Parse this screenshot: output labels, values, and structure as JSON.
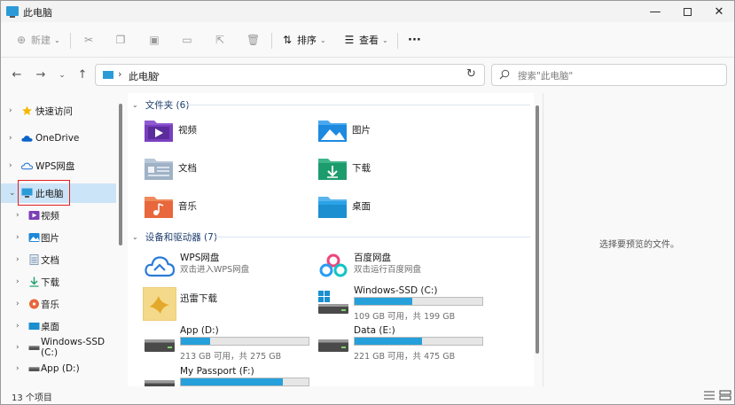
{
  "window": {
    "title": "此电脑",
    "controls": {
      "minimize": "—",
      "close": "✕"
    }
  },
  "commandbar": {
    "new_label": "新建",
    "sort_label": "排序",
    "view_label": "查看",
    "more_label": "···"
  },
  "address": {
    "path": "此电脑",
    "separator": "›"
  },
  "search": {
    "placeholder": "搜索\"此电脑\""
  },
  "sidebar": {
    "items": [
      {
        "label": "快速访问",
        "icon": "star-icon"
      },
      {
        "label": "OneDrive",
        "icon": "cloud-icon"
      },
      {
        "label": "WPS网盘",
        "icon": "wps-cloud-icon"
      },
      {
        "label": "此电脑",
        "icon": "computer-icon",
        "selected": true
      },
      {
        "label": "视频",
        "icon": "video-folder-icon"
      },
      {
        "label": "图片",
        "icon": "pictures-folder-icon"
      },
      {
        "label": "文档",
        "icon": "documents-folder-icon"
      },
      {
        "label": "下载",
        "icon": "download-icon"
      },
      {
        "label": "音乐",
        "icon": "music-icon"
      },
      {
        "label": "桌面",
        "icon": "desktop-folder-icon"
      },
      {
        "label": "Windows-SSD (C:)",
        "icon": "drive-icon"
      },
      {
        "label": "App (D:)",
        "icon": "drive-icon"
      }
    ]
  },
  "main": {
    "folders_header": "文件夹 (6)",
    "folders": [
      {
        "name": "视频",
        "icon": "video-folder-icon"
      },
      {
        "name": "图片",
        "icon": "pictures-folder-icon"
      },
      {
        "name": "文档",
        "icon": "documents-folder-icon"
      },
      {
        "name": "下载",
        "icon": "downloads-folder-icon"
      },
      {
        "name": "音乐",
        "icon": "music-folder-icon"
      },
      {
        "name": "桌面",
        "icon": "desktop-folder-icon"
      }
    ],
    "drives_header": "设备和驱动器 (7)",
    "drives": [
      {
        "name": "WPS网盘",
        "subtitle": "双击进入WPS网盘",
        "icon": "wps-cloud-icon"
      },
      {
        "name": "百度网盘",
        "subtitle": "双击运行百度网盘",
        "icon": "baidu-cloud-icon"
      },
      {
        "name": "迅雷下载",
        "icon": "xunlei-icon"
      },
      {
        "name": "Windows-SSD (C:)",
        "free_text": "109 GB 可用，共 199 GB",
        "used_fraction": 0.45,
        "icon": "windows-drive-icon"
      },
      {
        "name": "App (D:)",
        "free_text": "213 GB 可用，共 275 GB",
        "used_fraction": 0.23,
        "icon": "drive-icon"
      },
      {
        "name": "Data (E:)",
        "free_text": "221 GB 可用，共 475 GB",
        "used_fraction": 0.53,
        "icon": "drive-icon"
      },
      {
        "name": "My Passport (F:)",
        "used_fraction": 0.8,
        "icon": "drive-icon"
      }
    ]
  },
  "preview": {
    "message": "选择要预览的文件。"
  },
  "status": {
    "count": "13 个项目"
  },
  "colors": {
    "accent": "#26a0da",
    "selection": "#cce4f7",
    "highlight_box": "#e02020"
  }
}
